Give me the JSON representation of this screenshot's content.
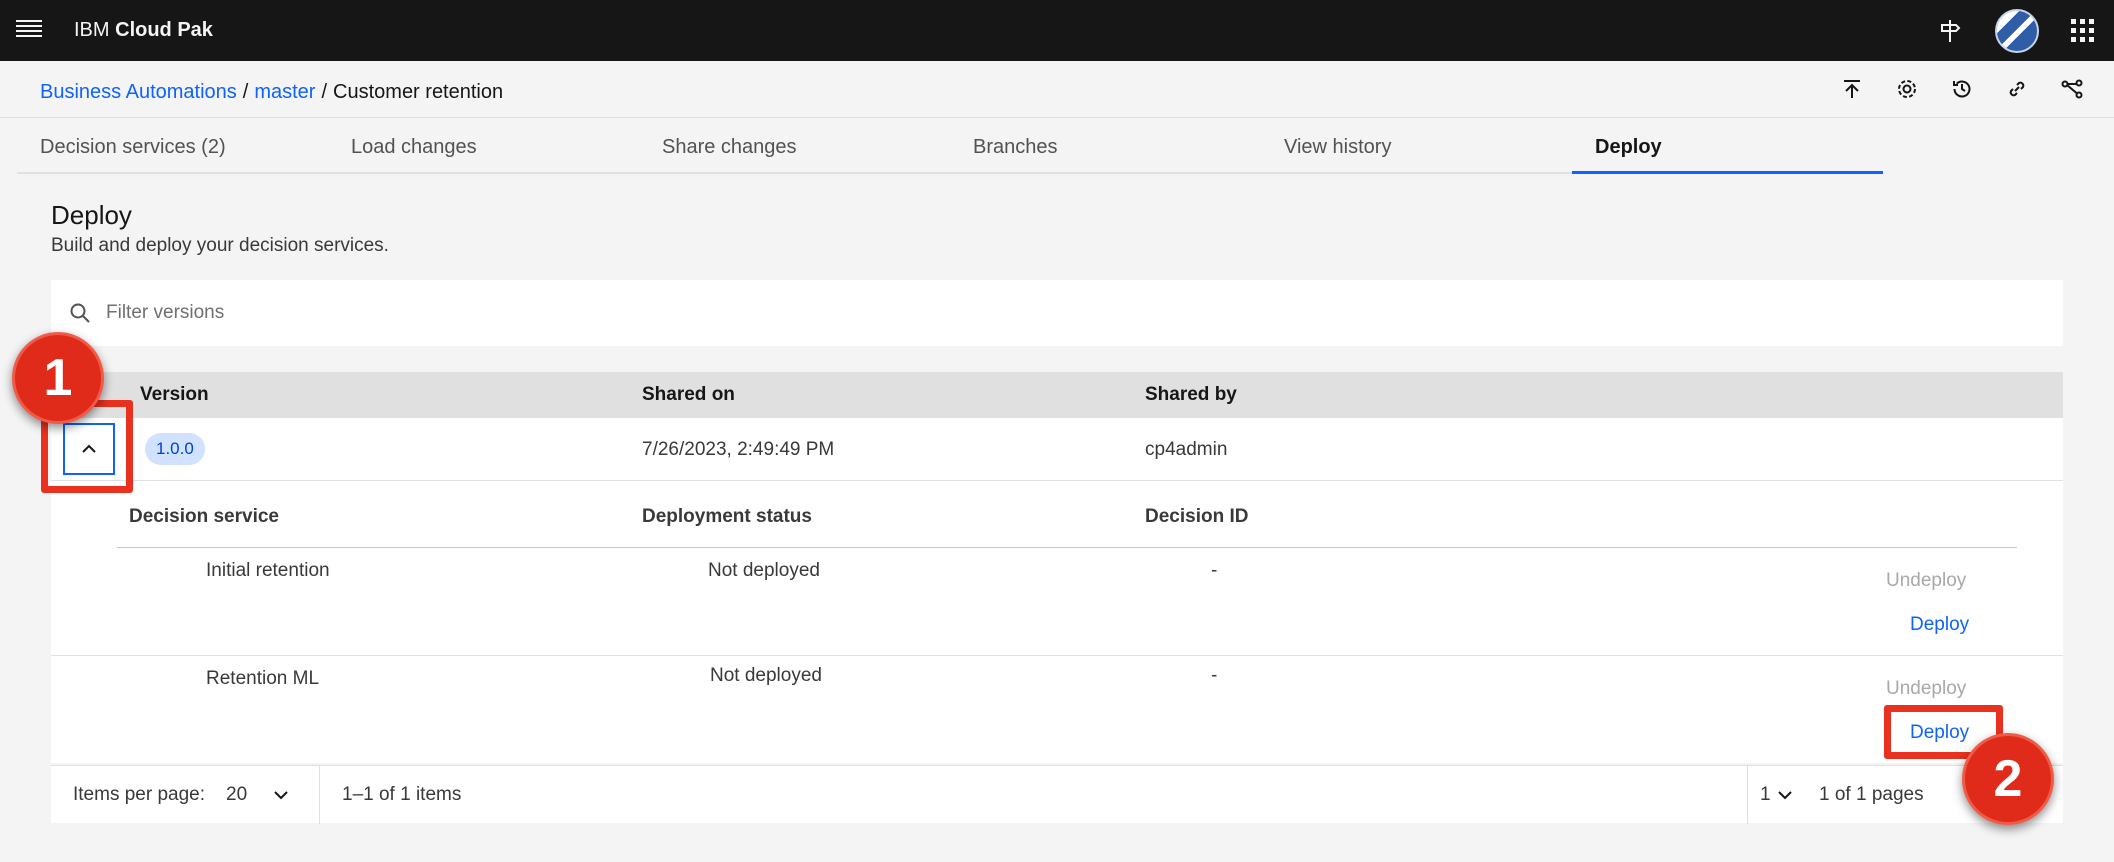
{
  "shell": {
    "brand_prefix": "IBM",
    "brand_name": "Cloud Pak"
  },
  "breadcrumb": {
    "items": [
      "Business Automations",
      "master",
      "Customer retention"
    ],
    "separator": "/"
  },
  "toolbar_icons": [
    "publish-icon",
    "settings-icon",
    "history-icon",
    "link-icon",
    "branch-icon"
  ],
  "tabs": [
    {
      "label": "Decision services (2)",
      "active": false
    },
    {
      "label": "Load changes",
      "active": false
    },
    {
      "label": "Share changes",
      "active": false
    },
    {
      "label": "Branches",
      "active": false
    },
    {
      "label": "View history",
      "active": false
    },
    {
      "label": "Deploy",
      "active": true
    }
  ],
  "page": {
    "title": "Deploy",
    "subtitle": "Build and deploy your decision services."
  },
  "search": {
    "placeholder": "Filter versions",
    "value": ""
  },
  "table": {
    "headers": [
      "Version",
      "Shared on",
      "Shared by"
    ],
    "row": {
      "version": "1.0.0",
      "shared_on": "7/26/2023, 2:49:49 PM",
      "shared_by": "cp4admin"
    }
  },
  "subtable": {
    "headers": [
      "Decision service",
      "Deployment status",
      "Decision ID"
    ],
    "rows": [
      {
        "service": "Initial retention",
        "status": "Not deployed",
        "decision_id": "-",
        "undeploy": "Undeploy",
        "deploy": "Deploy"
      },
      {
        "service": "Retention ML",
        "status": "Not deployed",
        "decision_id": "-",
        "undeploy": "Undeploy",
        "deploy": "Deploy"
      }
    ]
  },
  "pagination": {
    "items_per_page_label": "Items per page:",
    "items_per_page": "20",
    "range": "1–1 of 1 items",
    "page": "1",
    "pages": "1 of 1 pages"
  },
  "annotations": {
    "callout_1": "1",
    "callout_2": "2",
    "color": "#e8321f"
  },
  "colors": {
    "accent": "#0f62fe",
    "header_bg": "#161616",
    "tag_bg": "#d0e2ff"
  }
}
